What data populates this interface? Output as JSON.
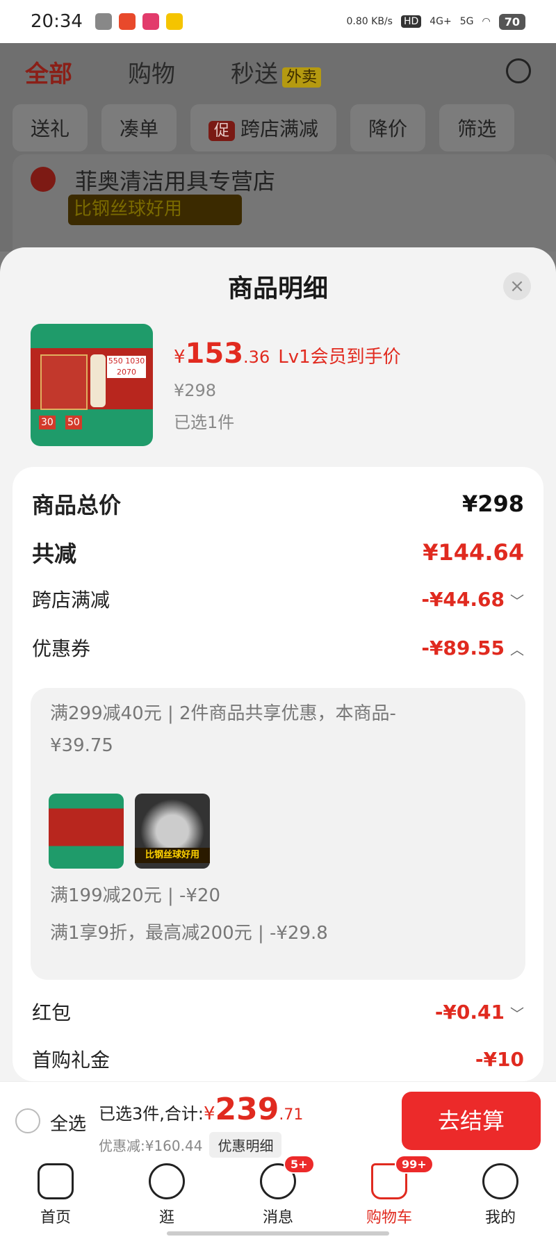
{
  "status_bar": {
    "time": "20:34",
    "net_speed": "0.80 KB/s",
    "hd": "HD",
    "signal1": "4G+",
    "signal2": "5G",
    "battery": "70"
  },
  "top_tabs": {
    "all": "全部",
    "shopping": "购物",
    "delivery": "秒送",
    "takeout": "外卖"
  },
  "filters": {
    "gift": "送礼",
    "bundle": "凑单",
    "promo_badge": "促",
    "cross_store": "跨店满减",
    "price_drop": "降价",
    "filter": "筛选"
  },
  "store": {
    "name": "菲奥清洁用具专营店",
    "banner": "比钢丝球好用"
  },
  "sheet": {
    "title": "商品明细",
    "close": "×",
    "product": {
      "currency": "¥",
      "price_int": "153",
      "price_dec": ".36",
      "member_note": "Lv1会员到手价",
      "original_price": "¥298",
      "selected": "已选1件",
      "thumb_tag1": "30",
      "thumb_tag2": "50",
      "thumb_prices": "550 1030 2070"
    },
    "rows": {
      "total_label": "商品总价",
      "total_value": "¥298",
      "reduce_label": "共减",
      "reduce_value": "¥144.64",
      "cross_label": "跨店满减",
      "cross_value": "-¥44.68",
      "coupon_label": "优惠券",
      "coupon_value": "-¥89.55",
      "redpack_label": "红包",
      "redpack_value": "-¥0.41",
      "firstbuy_label": "首购礼金",
      "firstbuy_value": "-¥10"
    },
    "coupon_details": {
      "line1": "满299减40元 | 2件商品共享优惠，本商品-¥39.75",
      "line2": "满199减20元 | -¥20",
      "line3": "满1享9折，最高减200元 | -¥29.8",
      "mini_b_band": "比钢丝球好用"
    }
  },
  "checkout": {
    "select_all": "全选",
    "summary_prefix": "已选3件,合计:",
    "currency": "¥",
    "total_int": "239",
    "total_dec": ".71",
    "discount": "优惠减:¥160.44",
    "detail": "优惠明细",
    "button": "去结算"
  },
  "tab_bar": {
    "home": "首页",
    "browse": "逛",
    "messages": "消息",
    "messages_badge": "5+",
    "cart": "购物车",
    "cart_badge": "99+",
    "mine": "我的"
  },
  "colors": {
    "accent": "#e02a1f",
    "button": "#ec2a2a"
  }
}
